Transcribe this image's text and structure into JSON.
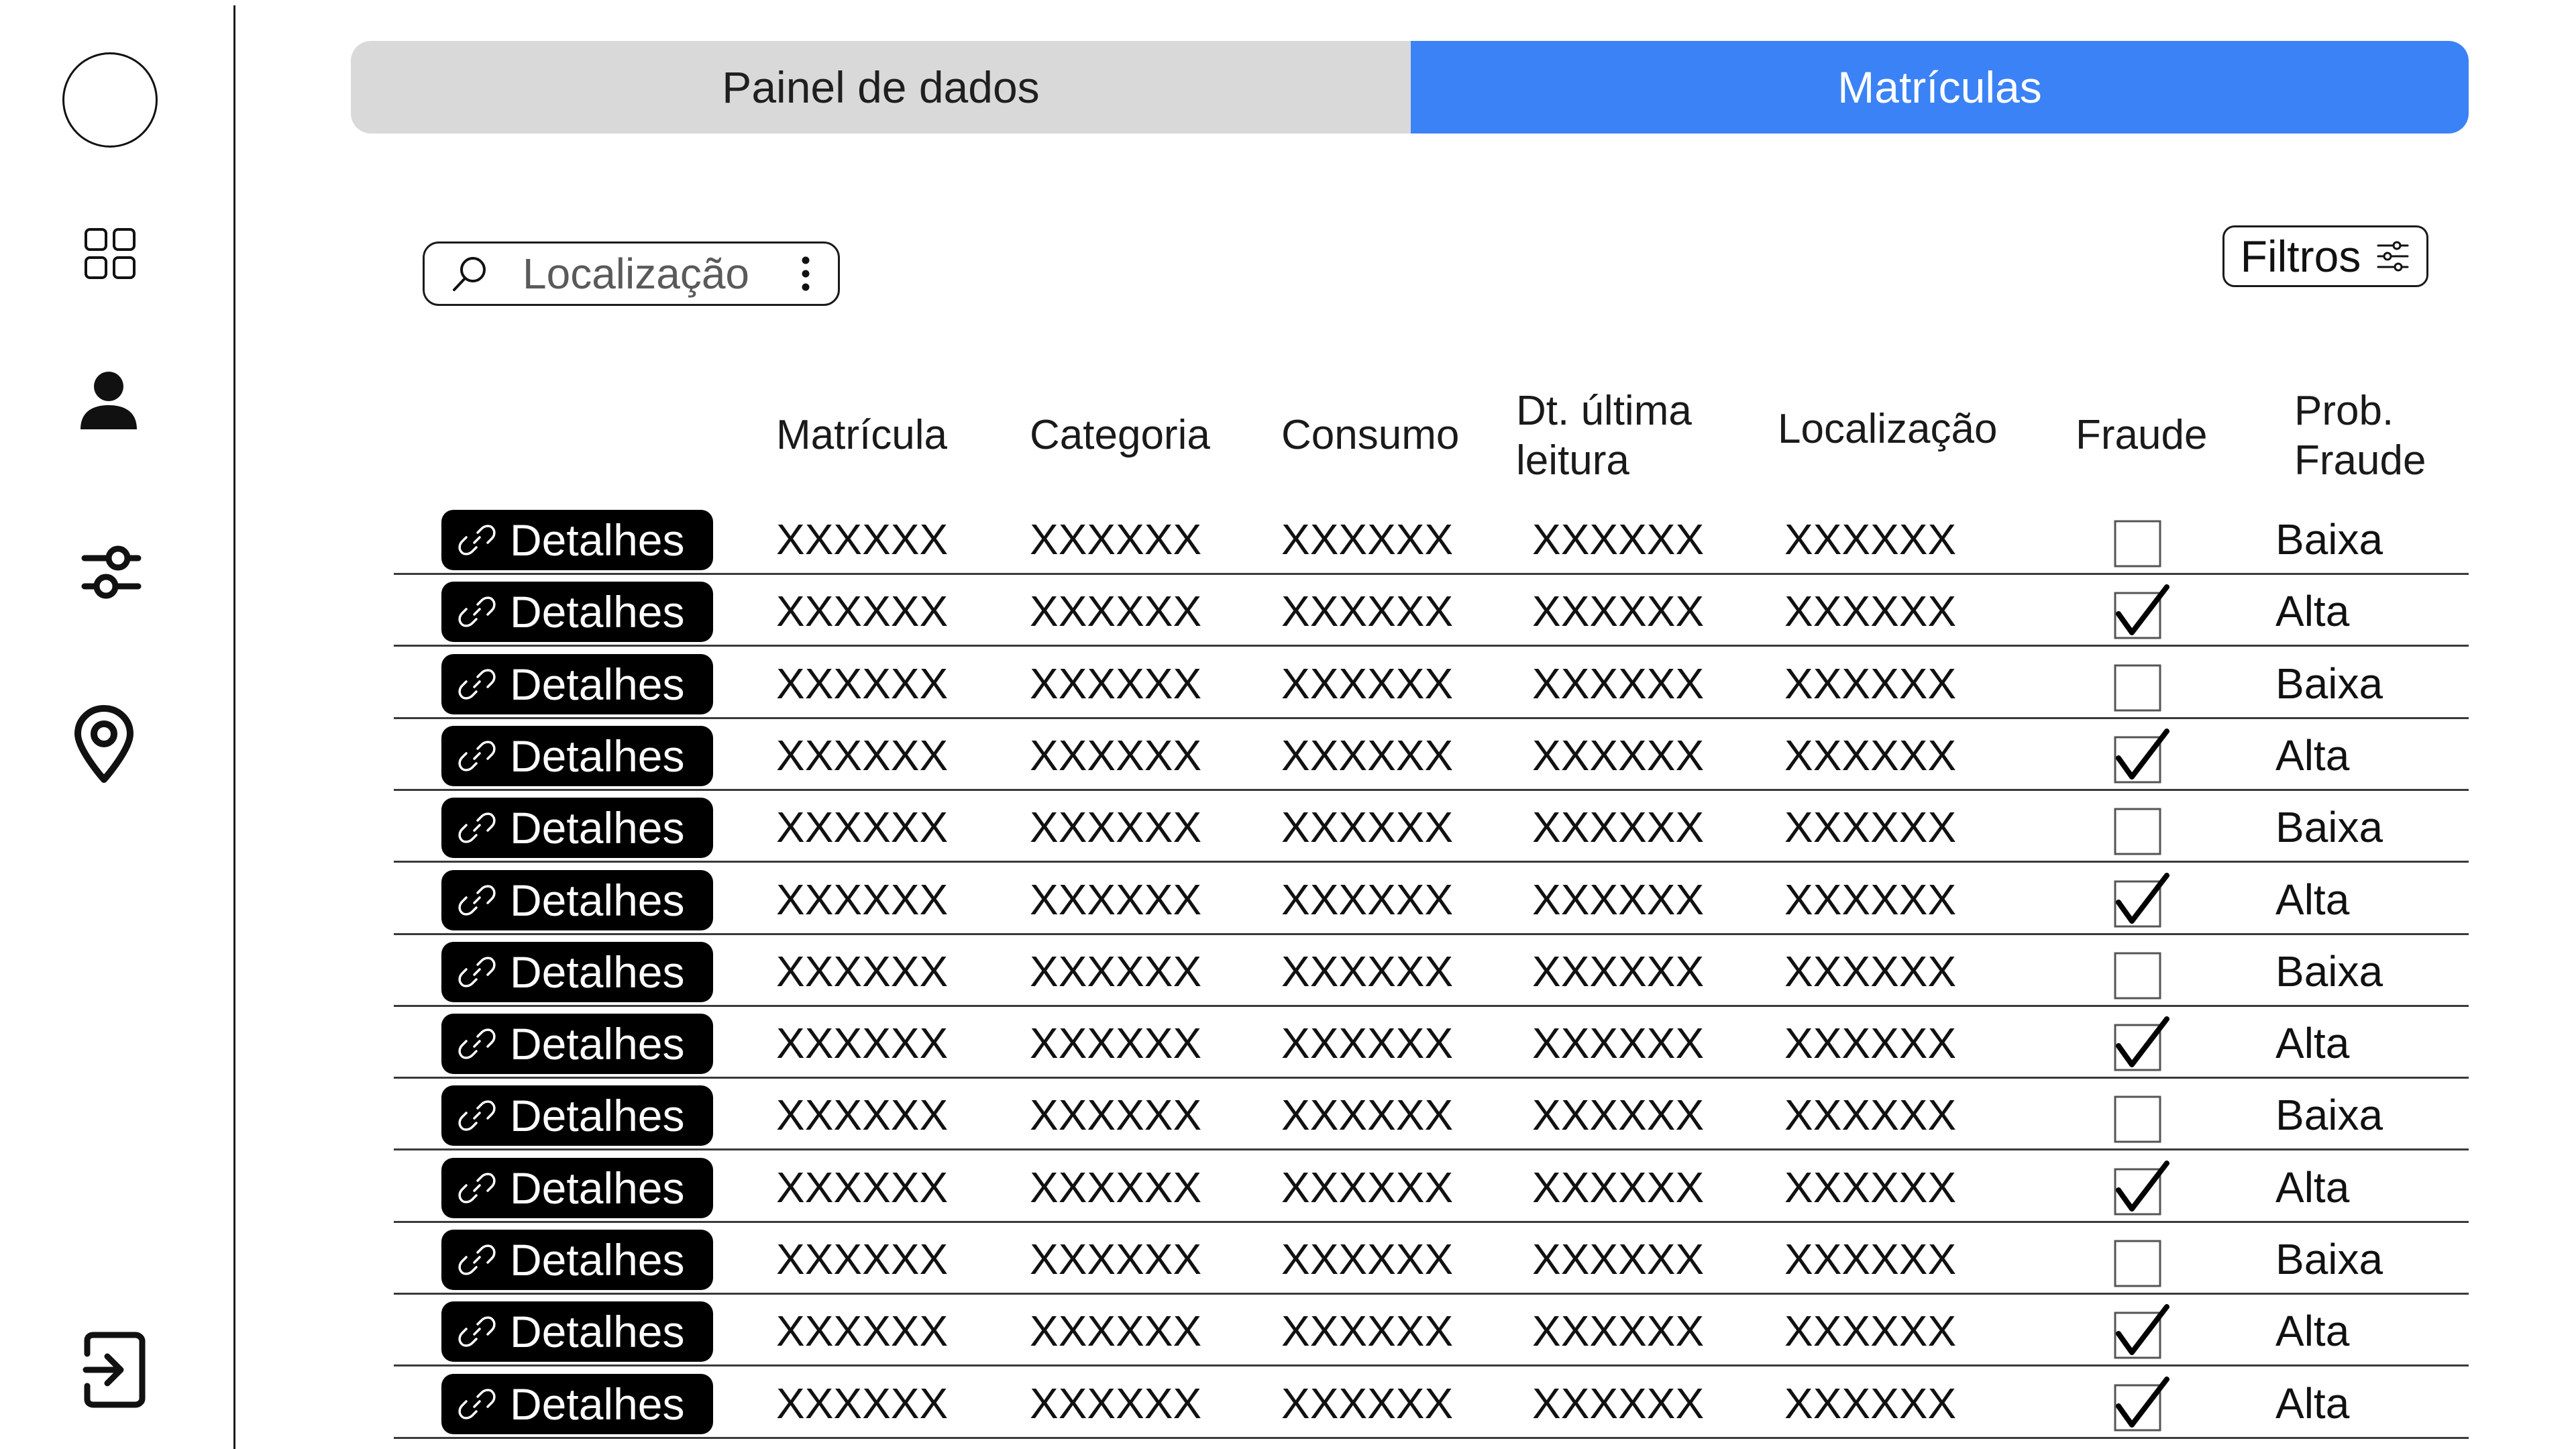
{
  "tabs": [
    {
      "label": "Painel de dados",
      "active": false
    },
    {
      "label": "Matrículas",
      "active": true
    }
  ],
  "accent_color": "#3b82f6",
  "sidebar": {
    "items": [
      {
        "icon": "avatar"
      },
      {
        "icon": "dashboard-grid-icon"
      },
      {
        "icon": "user-icon"
      },
      {
        "icon": "sliders-icon"
      },
      {
        "icon": "location-pin-icon"
      },
      {
        "icon": "logout-icon"
      }
    ]
  },
  "search": {
    "placeholder": "Localização"
  },
  "filters": {
    "label": "Filtros"
  },
  "table": {
    "headers": [
      "Matrícula",
      "Categoria",
      "Consumo",
      "Dt. última leitura",
      "Localização",
      "Fraude",
      "Prob. Fraude"
    ],
    "header_lines": {
      "dt_ultima_1": "Dt. última",
      "dt_ultima_2": "leitura",
      "prob_1": "Prob.",
      "prob_2": "Fraude"
    },
    "details_label": "Detalhes",
    "rows": [
      {
        "matricula": "XXXXXX",
        "categoria": "XXXXXX",
        "consumo": "XXXXXX",
        "dt_ultima_leitura": "XXXXXX",
        "localizacao": "XXXXXX",
        "fraude": false,
        "prob_fraude": "Baixa"
      },
      {
        "matricula": "XXXXXX",
        "categoria": "XXXXXX",
        "consumo": "XXXXXX",
        "dt_ultima_leitura": "XXXXXX",
        "localizacao": "XXXXXX",
        "fraude": true,
        "prob_fraude": "Alta"
      },
      {
        "matricula": "XXXXXX",
        "categoria": "XXXXXX",
        "consumo": "XXXXXX",
        "dt_ultima_leitura": "XXXXXX",
        "localizacao": "XXXXXX",
        "fraude": false,
        "prob_fraude": "Baixa"
      },
      {
        "matricula": "XXXXXX",
        "categoria": "XXXXXX",
        "consumo": "XXXXXX",
        "dt_ultima_leitura": "XXXXXX",
        "localizacao": "XXXXXX",
        "fraude": true,
        "prob_fraude": "Alta"
      },
      {
        "matricula": "XXXXXX",
        "categoria": "XXXXXX",
        "consumo": "XXXXXX",
        "dt_ultima_leitura": "XXXXXX",
        "localizacao": "XXXXXX",
        "fraude": false,
        "prob_fraude": "Baixa"
      },
      {
        "matricula": "XXXXXX",
        "categoria": "XXXXXX",
        "consumo": "XXXXXX",
        "dt_ultima_leitura": "XXXXXX",
        "localizacao": "XXXXXX",
        "fraude": true,
        "prob_fraude": "Alta"
      },
      {
        "matricula": "XXXXXX",
        "categoria": "XXXXXX",
        "consumo": "XXXXXX",
        "dt_ultima_leitura": "XXXXXX",
        "localizacao": "XXXXXX",
        "fraude": false,
        "prob_fraude": "Baixa"
      },
      {
        "matricula": "XXXXXX",
        "categoria": "XXXXXX",
        "consumo": "XXXXXX",
        "dt_ultima_leitura": "XXXXXX",
        "localizacao": "XXXXXX",
        "fraude": true,
        "prob_fraude": "Alta"
      },
      {
        "matricula": "XXXXXX",
        "categoria": "XXXXXX",
        "consumo": "XXXXXX",
        "dt_ultima_leitura": "XXXXXX",
        "localizacao": "XXXXXX",
        "fraude": false,
        "prob_fraude": "Baixa"
      },
      {
        "matricula": "XXXXXX",
        "categoria": "XXXXXX",
        "consumo": "XXXXXX",
        "dt_ultima_leitura": "XXXXXX",
        "localizacao": "XXXXXX",
        "fraude": true,
        "prob_fraude": "Alta"
      },
      {
        "matricula": "XXXXXX",
        "categoria": "XXXXXX",
        "consumo": "XXXXXX",
        "dt_ultima_leitura": "XXXXXX",
        "localizacao": "XXXXXX",
        "fraude": false,
        "prob_fraude": "Baixa"
      },
      {
        "matricula": "XXXXXX",
        "categoria": "XXXXXX",
        "consumo": "XXXXXX",
        "dt_ultima_leitura": "XXXXXX",
        "localizacao": "XXXXXX",
        "fraude": true,
        "prob_fraude": "Alta"
      },
      {
        "matricula": "XXXXXX",
        "categoria": "XXXXXX",
        "consumo": "XXXXXX",
        "dt_ultima_leitura": "XXXXXX",
        "localizacao": "XXXXXX",
        "fraude": true,
        "prob_fraude": "Alta"
      }
    ]
  }
}
